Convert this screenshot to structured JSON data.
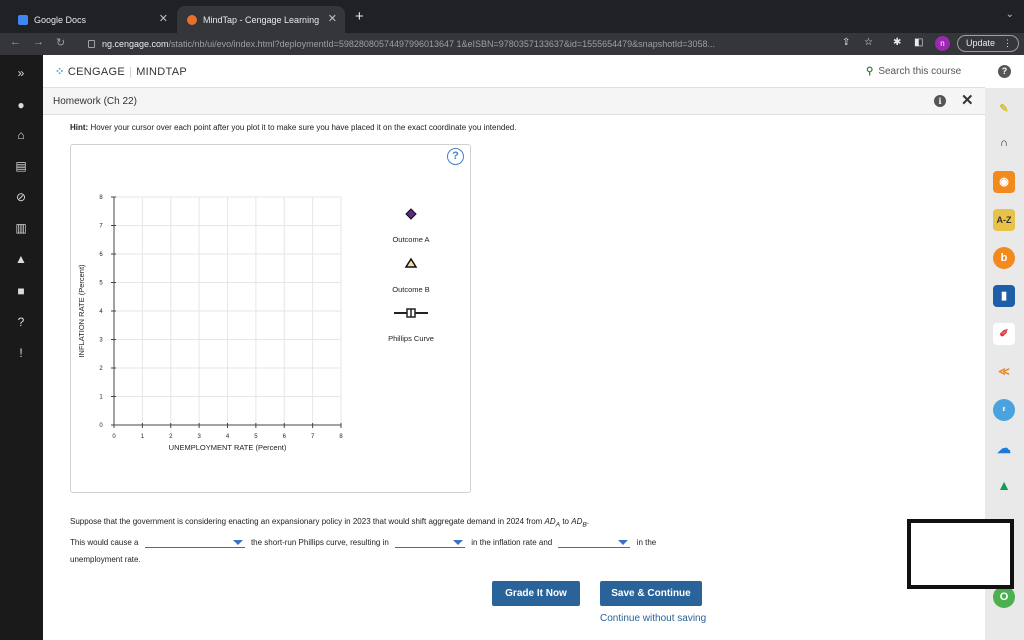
{
  "browser": {
    "tabs": [
      {
        "title": "Google Docs",
        "icon": "google-docs-icon"
      },
      {
        "title": "MindTap - Cengage Learning",
        "icon": "mindtap-icon"
      }
    ],
    "url_host": "ng.cengage.com",
    "url_path": "/static/nb/ui/evo/index.html?deploymentId=59828080574497996013647 1&eISBN=9780357133637&id=1555654479&snapshotId=3058...",
    "profile_initial": "n",
    "update_label": "Update"
  },
  "app": {
    "logo_cengage": "CENGAGE",
    "logo_mindtap": "MINDTAP",
    "search_label": "Search this course",
    "page_title": "Homework (Ch 22)"
  },
  "hint": {
    "label": "Hint:",
    "text": " Hover your cursor over each point after you plot it to make sure you have placed it on the exact coordinate you intended."
  },
  "chart_data": {
    "type": "scatter",
    "xlabel": "UNEMPLOYMENT RATE (Percent)",
    "ylabel": "INFLATION RATE (Percent)",
    "xlim": [
      0,
      8
    ],
    "ylim": [
      0,
      8
    ],
    "xticks": [
      "0",
      "1",
      "2",
      "3",
      "4",
      "5",
      "6",
      "7",
      "8"
    ],
    "yticks": [
      "0",
      "1",
      "2",
      "3",
      "4",
      "5",
      "6",
      "7",
      "8"
    ],
    "grid": true,
    "series": [],
    "legend": [
      {
        "name": "Outcome A",
        "marker": "diamond",
        "color": "#5b2a86"
      },
      {
        "name": "Outcome B",
        "marker": "triangle",
        "color": "#f2e39b"
      },
      {
        "name": "Phillips Curve",
        "marker": "line-cross",
        "color": "#222222"
      }
    ]
  },
  "question": {
    "line1_a": "Suppose that the government is considering enacting an expansionary policy in 2023 that would shift aggregate demand in 2024 from ",
    "ad_a": "AD",
    "ad_a_sub": "A",
    "to": " to ",
    "ad_b": "AD",
    "ad_b_sub": "B",
    "period": ".",
    "line2_a": "This would cause a",
    "line2_b": "the short-run Phillips curve, resulting in",
    "line2_c": "in the inflation rate and",
    "line2_d": "in the",
    "line3": "unemployment rate."
  },
  "buttons": {
    "grade": "Grade It Now",
    "save": "Save & Continue",
    "continue": "Continue without saving"
  }
}
